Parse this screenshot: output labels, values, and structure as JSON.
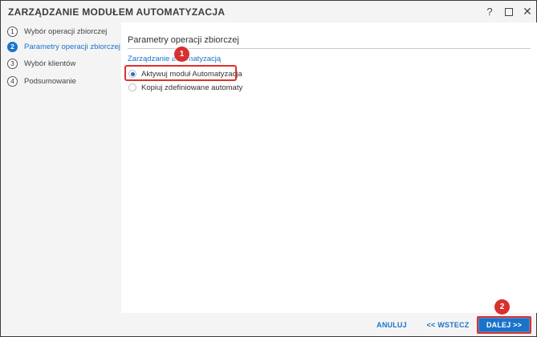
{
  "window": {
    "title": "ZARZĄDZANIE MODUŁEM AUTOMATYZACJA",
    "help_label": "?",
    "close_label": "✕"
  },
  "steps": [
    {
      "number": "1",
      "label": "Wybór operacji zbiorczej",
      "active": false
    },
    {
      "number": "2",
      "label": "Parametry operacji zbiorczej",
      "active": true
    },
    {
      "number": "3",
      "label": "Wybór klientów",
      "active": false
    },
    {
      "number": "4",
      "label": "Podsumowanie",
      "active": false
    }
  ],
  "content": {
    "section_title": "Parametry operacji zbiorczej",
    "group_label": "Zarządzanie automatyzacją",
    "options": [
      {
        "label": "Aktywuj moduł Automatyzacja",
        "checked": true
      },
      {
        "label": "Kopiuj zdefiniowane automaty",
        "checked": false
      }
    ]
  },
  "annotations": {
    "marker_1": "1",
    "marker_2": "2"
  },
  "footer": {
    "cancel_label": "ANULUJ",
    "back_label": "<< WSTECZ",
    "next_label": "DALEJ >>"
  },
  "colors": {
    "accent": "#1a73c9",
    "highlight": "#e0302c"
  }
}
